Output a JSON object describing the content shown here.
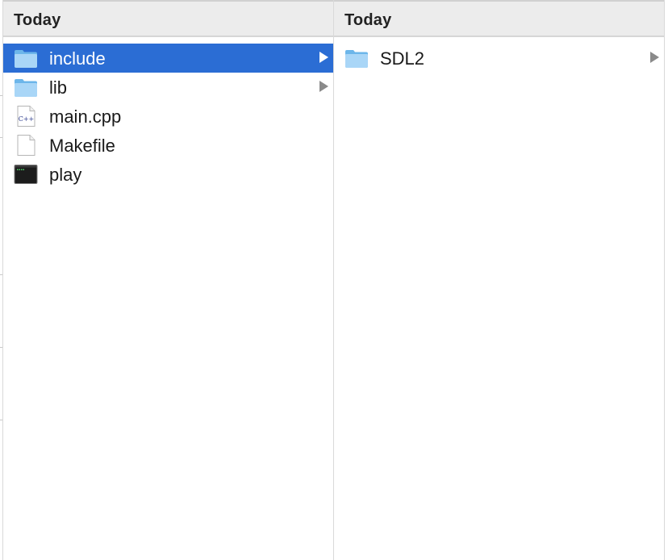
{
  "columns": [
    {
      "header": "Today",
      "items": [
        {
          "label": "include",
          "kind": "folder",
          "icon": "folder-icon",
          "selected": true,
          "has_children": true
        },
        {
          "label": "lib",
          "kind": "folder",
          "icon": "folder-icon",
          "selected": false,
          "has_children": true
        },
        {
          "label": "main.cpp",
          "kind": "cpp-file",
          "icon": "cpp-file-icon",
          "icon_text": "C++",
          "selected": false,
          "has_children": false
        },
        {
          "label": "Makefile",
          "kind": "file",
          "icon": "document-icon",
          "selected": false,
          "has_children": false
        },
        {
          "label": "play",
          "kind": "executable",
          "icon": "terminal-executable-icon",
          "selected": false,
          "has_children": false
        }
      ]
    },
    {
      "header": "Today",
      "items": [
        {
          "label": "SDL2",
          "kind": "folder",
          "icon": "folder-icon",
          "selected": false,
          "has_children": true
        }
      ]
    }
  ],
  "colors": {
    "selection": "#2b6dd4",
    "folder_light": "#a9d6f7",
    "folder_dark": "#6cb6ea",
    "header_bg": "#ececec"
  }
}
